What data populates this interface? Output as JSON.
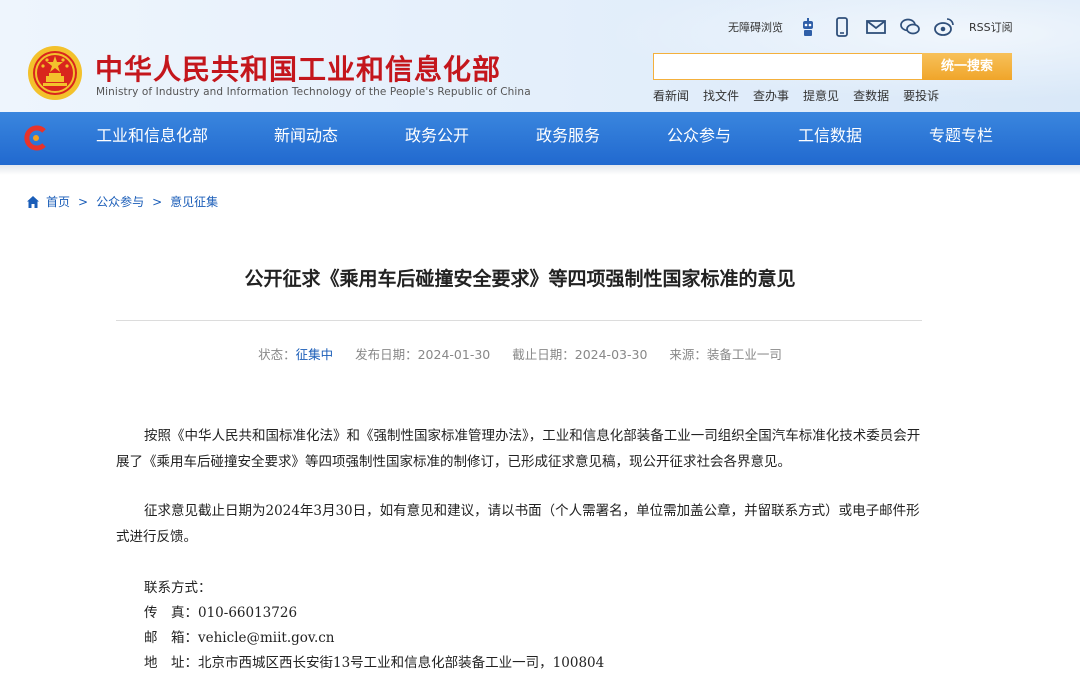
{
  "header": {
    "site_name_cn": "中华人民共和国工业和信息化部",
    "site_name_en": "Ministry of Industry and Information Technology of the People's Republic of China",
    "util": {
      "accessibility": "无障碍浏览",
      "rss": "RSS订阅",
      "icons": [
        "robot-icon",
        "mobile-icon",
        "mail-icon",
        "wechat-icon",
        "weibo-icon"
      ]
    },
    "search": {
      "placeholder": "",
      "button": "统一搜索"
    },
    "quick_links": [
      "看新闻",
      "找文件",
      "查办事",
      "提意见",
      "查数据",
      "要投诉"
    ]
  },
  "nav": {
    "items": [
      "工业和信息化部",
      "新闻动态",
      "政务公开",
      "政务服务",
      "公众参与",
      "工信数据",
      "专题专栏"
    ]
  },
  "breadcrumb": {
    "items": [
      "首页",
      "公众参与",
      "意见征集"
    ],
    "separator": ">"
  },
  "article": {
    "title": "公开征求《乘用车后碰撞安全要求》等四项强制性国家标准的意见",
    "meta": {
      "status_label": "状态：",
      "status_value": "征集中",
      "publish_label": "发布日期：",
      "publish_value": "2024-01-30",
      "deadline_label": "截止日期：",
      "deadline_value": "2024-03-30",
      "source_label": "来源：",
      "source_value": "装备工业一司"
    },
    "paragraphs": [
      "按照《中华人民共和国标准化法》和《强制性国家标准管理办法》，工业和信息化部装备工业一司组织全国汽车标准化技术委员会开展了《乘用车后碰撞安全要求》等四项强制性国家标准的制修订，已形成征求意见稿，现公开征求社会各界意见。",
      "征求意见截止日期为2024年3月30日，如有意见和建议，请以书面（个人需署名，单位需加盖公章，并留联系方式）或电子邮件形式进行反馈。"
    ],
    "contact": {
      "heading": "联系方式：",
      "fax": "传　真：010-66013726",
      "email": "邮　箱：vehicle@miit.gov.cn",
      "address": "地　址：北京市西城区西长安街13号工业和信息化部装备工业一司，100804"
    }
  },
  "colors": {
    "brand_red": "#c4161c",
    "nav_blue": "#2169cf",
    "link_blue": "#1a5db8",
    "search_orange": "#f0a52a"
  }
}
